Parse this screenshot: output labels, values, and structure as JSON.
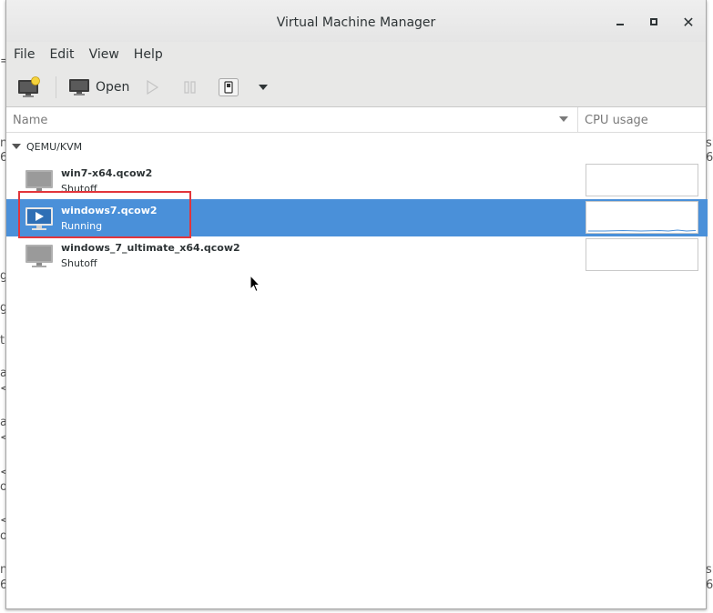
{
  "window": {
    "title": "Virtual Machine Manager"
  },
  "menubar": {
    "items": [
      "File",
      "Edit",
      "View",
      "Help"
    ]
  },
  "toolbar": {
    "open_label": "Open"
  },
  "columns": {
    "name": "Name",
    "cpu": "CPU usage"
  },
  "group": {
    "label": "QEMU/KVM"
  },
  "vms": [
    {
      "name": "win7-x64.qcow2",
      "status": "Shutoff",
      "selected": false
    },
    {
      "name": "windows7.qcow2",
      "status": "Running",
      "selected": true
    },
    {
      "name": "windows_7_ultimate_x64.qcow2",
      "status": "Shutoff",
      "selected": false
    }
  ],
  "background_fragments": {
    "left": [
      "n",
      "6",
      "=",
      "g",
      "g",
      "t",
      "a",
      "<",
      "a",
      "<",
      "<",
      "o",
      "<",
      "o",
      "n",
      "6"
    ],
    "right": [
      "sl",
      "6",
      "sl",
      "6"
    ]
  },
  "colors": {
    "selection": "#4a90d9",
    "highlight": "#e2353b"
  }
}
